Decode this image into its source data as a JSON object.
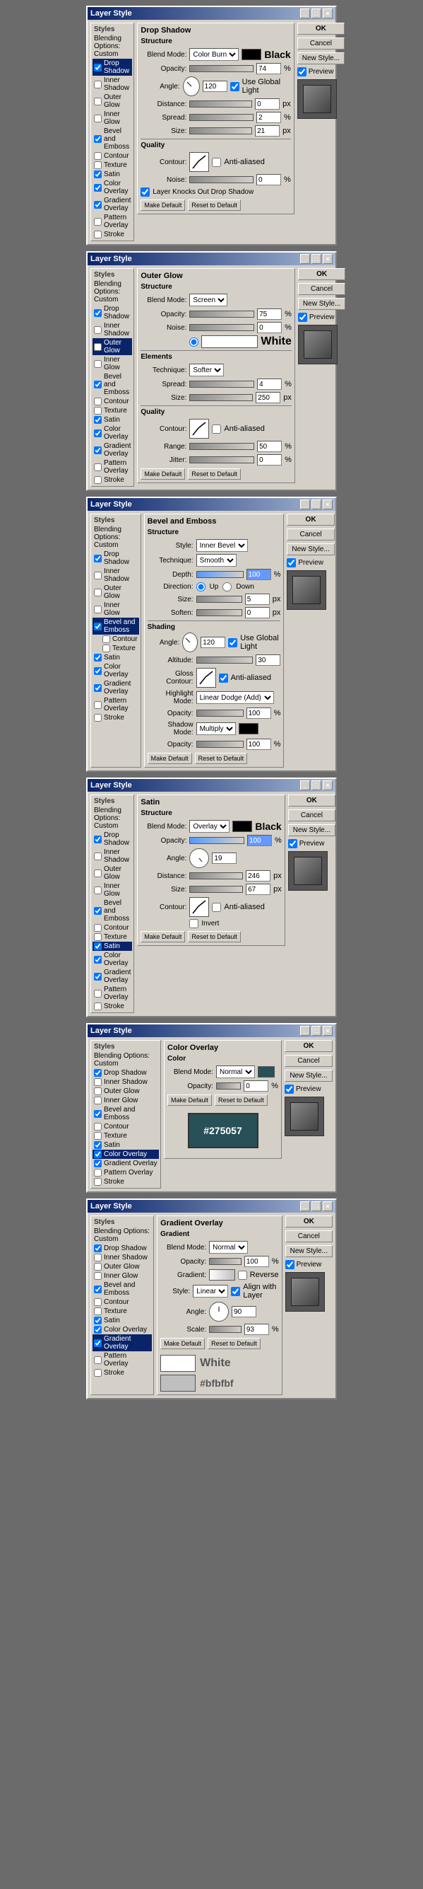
{
  "dialogs": [
    {
      "id": "drop-shadow",
      "title": "Layer Style",
      "active_style": "Drop Shadow",
      "styles": [
        {
          "label": "Styles",
          "type": "heading"
        },
        {
          "label": "Blending Options: Custom",
          "checked": null,
          "type": "blending"
        },
        {
          "label": "Drop Shadow",
          "checked": true,
          "active": true
        },
        {
          "label": "Inner Shadow",
          "checked": false
        },
        {
          "label": "Outer Glow",
          "checked": false
        },
        {
          "label": "Inner Glow",
          "checked": false
        },
        {
          "label": "Bevel and Emboss",
          "checked": true
        },
        {
          "label": "Contour",
          "checked": false
        },
        {
          "label": "Texture",
          "checked": false
        },
        {
          "label": "Satin",
          "checked": true
        },
        {
          "label": "Color Overlay",
          "checked": true
        },
        {
          "label": "Gradient Overlay",
          "checked": true
        },
        {
          "label": "Pattern Overlay",
          "checked": false
        },
        {
          "label": "Stroke",
          "checked": false
        }
      ],
      "section_title": "Drop Shadow",
      "structure": {
        "blend_mode": "Color Burn",
        "blend_color": "#000000",
        "blend_color_label": "Black",
        "opacity": 74,
        "angle": 120,
        "use_global_light": true,
        "distance": 0,
        "spread": 2,
        "size": 21
      },
      "quality": {
        "noise": 0,
        "layer_knocks_out": true,
        "anti_aliased": false
      },
      "buttons": {
        "ok": "OK",
        "cancel": "Cancel",
        "new_style": "New Style...",
        "preview": "Preview"
      }
    },
    {
      "id": "outer-glow",
      "title": "Layer Style",
      "active_style": "Outer Glow",
      "styles": [
        {
          "label": "Styles",
          "type": "heading"
        },
        {
          "label": "Blending Options: Custom",
          "type": "blending"
        },
        {
          "label": "Drop Shadow",
          "checked": true
        },
        {
          "label": "Inner Shadow",
          "checked": false
        },
        {
          "label": "Outer Glow",
          "checked": false,
          "active": true
        },
        {
          "label": "Inner Glow",
          "checked": false
        },
        {
          "label": "Bevel and Emboss",
          "checked": true
        },
        {
          "label": "Contour",
          "checked": false
        },
        {
          "label": "Texture",
          "checked": false
        },
        {
          "label": "Satin",
          "checked": true
        },
        {
          "label": "Color Overlay",
          "checked": true
        },
        {
          "label": "Gradient Overlay",
          "checked": true
        },
        {
          "label": "Pattern Overlay",
          "checked": false
        },
        {
          "label": "Stroke",
          "checked": false
        }
      ],
      "section_title": "Outer Glow",
      "structure": {
        "blend_mode": "Screen",
        "opacity": 75,
        "noise": 0,
        "color_type": "solid",
        "color_display": "White"
      },
      "elements": {
        "technique": "Softer",
        "spread": 4,
        "size": 250
      },
      "quality": {
        "range": 50,
        "jitter": 0,
        "anti_aliased": false
      }
    },
    {
      "id": "bevel-emboss",
      "title": "Layer Style",
      "active_style": "Bevel and Emboss",
      "styles": [
        {
          "label": "Styles",
          "type": "heading"
        },
        {
          "label": "Blending Options: Custom",
          "type": "blending"
        },
        {
          "label": "Drop Shadow",
          "checked": true
        },
        {
          "label": "Inner Shadow",
          "checked": false
        },
        {
          "label": "Outer Glow",
          "checked": false
        },
        {
          "label": "Inner Glow",
          "checked": false
        },
        {
          "label": "Bevel and Emboss",
          "checked": true,
          "active": true
        },
        {
          "label": "Contour",
          "checked": false,
          "sub": true
        },
        {
          "label": "Texture",
          "checked": false,
          "sub": true
        },
        {
          "label": "Satin",
          "checked": true
        },
        {
          "label": "Color Overlay",
          "checked": true
        },
        {
          "label": "Gradient Overlay",
          "checked": true
        },
        {
          "label": "Pattern Overlay",
          "checked": false
        },
        {
          "label": "Stroke",
          "checked": false
        }
      ],
      "section_title": "Bevel and Emboss",
      "structure": {
        "style": "Inner Bevel",
        "technique": "Smooth",
        "depth": 100,
        "direction_up": true,
        "direction_down": false,
        "size": 5,
        "soften": 0
      },
      "shading": {
        "angle": 120,
        "use_global_light": true,
        "altitude": 30,
        "gloss_contour": "curve",
        "anti_aliased": true,
        "highlight_mode": "Linear Dodge (Add)",
        "highlight_opacity": 100,
        "shadow_mode": "Multiply",
        "shadow_color": "#000000",
        "shadow_opacity": 100
      }
    },
    {
      "id": "satin",
      "title": "Layer Style",
      "active_style": "Satin",
      "styles": [
        {
          "label": "Styles",
          "type": "heading"
        },
        {
          "label": "Blending Options: Custom",
          "type": "blending"
        },
        {
          "label": "Drop Shadow",
          "checked": true
        },
        {
          "label": "Inner Shadow",
          "checked": false
        },
        {
          "label": "Outer Glow",
          "checked": false
        },
        {
          "label": "Inner Glow",
          "checked": false
        },
        {
          "label": "Bevel and Emboss",
          "checked": true
        },
        {
          "label": "Contour",
          "checked": false
        },
        {
          "label": "Texture",
          "checked": false
        },
        {
          "label": "Satin",
          "checked": true,
          "active": true
        },
        {
          "label": "Color Overlay",
          "checked": true
        },
        {
          "label": "Gradient Overlay",
          "checked": true
        },
        {
          "label": "Pattern Overlay",
          "checked": false
        },
        {
          "label": "Stroke",
          "checked": false
        }
      ],
      "section_title": "Satin",
      "structure": {
        "blend_mode": "Overlay",
        "color": "#000000",
        "color_label": "Black",
        "opacity": 100,
        "angle": 19,
        "distance": 246,
        "size": 67,
        "contour": "custom",
        "anti_aliased": false,
        "invert": false
      }
    },
    {
      "id": "color-overlay",
      "title": "Layer Style",
      "active_style": "Color Overlay",
      "styles": [
        {
          "label": "Styles",
          "type": "heading"
        },
        {
          "label": "Blending Options: Custom",
          "type": "blending"
        },
        {
          "label": "Drop Shadow",
          "checked": true
        },
        {
          "label": "Inner Shadow",
          "checked": false
        },
        {
          "label": "Outer Glow",
          "checked": false
        },
        {
          "label": "Inner Glow",
          "checked": false
        },
        {
          "label": "Bevel and Emboss",
          "checked": true
        },
        {
          "label": "Contour",
          "checked": false
        },
        {
          "label": "Texture",
          "checked": false
        },
        {
          "label": "Satin",
          "checked": true
        },
        {
          "label": "Color Overlay",
          "checked": true,
          "active": true
        },
        {
          "label": "Gradient Overlay",
          "checked": true
        },
        {
          "label": "Pattern Overlay",
          "checked": false
        },
        {
          "label": "Stroke",
          "checked": false
        }
      ],
      "section_title": "Color Overlay",
      "color": {
        "blend_mode": "Normal",
        "opacity": 0,
        "color_value": "#275057",
        "color_display": "#275057"
      }
    },
    {
      "id": "gradient-overlay",
      "title": "Layer Style",
      "active_style": "Gradient Overlay",
      "styles": [
        {
          "label": "Styles",
          "type": "heading"
        },
        {
          "label": "Blending Options: Custom",
          "type": "blending"
        },
        {
          "label": "Drop Shadow",
          "checked": true
        },
        {
          "label": "Inner Shadow",
          "checked": false
        },
        {
          "label": "Outer Glow",
          "checked": false
        },
        {
          "label": "Inner Glow",
          "checked": false
        },
        {
          "label": "Bevel and Emboss",
          "checked": true
        },
        {
          "label": "Contour",
          "checked": false
        },
        {
          "label": "Texture",
          "checked": false
        },
        {
          "label": "Satin",
          "checked": true
        },
        {
          "label": "Color Overlay",
          "checked": true
        },
        {
          "label": "Gradient Overlay",
          "checked": true,
          "active": true
        },
        {
          "label": "Pattern Overlay",
          "checked": false
        },
        {
          "label": "Stroke",
          "checked": false
        }
      ],
      "section_title": "Gradient Overlay",
      "gradient": {
        "blend_mode": "Normal",
        "opacity": 100,
        "reverse": false,
        "style": "Linear",
        "align_with_layer": true,
        "angle": 90,
        "scale": 93,
        "color_start": "#ffffff",
        "color_start_label": "White",
        "color_end": "#bfbfbf",
        "color_end_label": "#bfbfbf"
      }
    }
  ],
  "buttons": {
    "ok": "OK",
    "cancel": "Cancel",
    "new_style": "New Style...",
    "preview": "Preview",
    "make_default": "Make Default",
    "reset_to_default": "Reset to Default"
  },
  "labels": {
    "structure": "Structure",
    "quality": "Quality",
    "elements": "Elements",
    "shading": "Shading",
    "color": "Color",
    "gradient": "Gradient",
    "blend_mode": "Blend Mode:",
    "opacity": "Opacity:",
    "angle": "Angle:",
    "distance": "Distance:",
    "spread": "Spread:",
    "size": "Size:",
    "noise": "Noise:",
    "contour": "Contour:",
    "anti_aliased": "Anti-aliased",
    "use_global_light": "Use Global Light",
    "layer_knocks_out": "Layer Knocks Out Drop Shadow",
    "technique": "Technique:",
    "style": "Style:",
    "depth": "Depth:",
    "direction": "Direction:",
    "up": "Up",
    "down": "Down",
    "soften": "Soften:",
    "altitude": "Altitude:",
    "gloss_contour": "Gloss Contour:",
    "highlight_mode": "Highlight Mode:",
    "shadow_mode": "Shadow Mode:",
    "range": "Range:",
    "jitter": "Jitter:",
    "invert": "Invert",
    "reverse": "Reverse",
    "align_with_layer": "Align with Layer",
    "scale": "Scale:",
    "px": "px",
    "percent": "%",
    "normal": "Normal",
    "overlay": "Overlay",
    "screen": "Screen",
    "multiply": "Multiply",
    "color_burn": "Color Burn",
    "linear": "Linear",
    "softer": "Softer",
    "inner_bevel": "Inner Bevel",
    "smooth": "Smooth",
    "linear_dodge_add": "Linear Dodge (Add)"
  }
}
